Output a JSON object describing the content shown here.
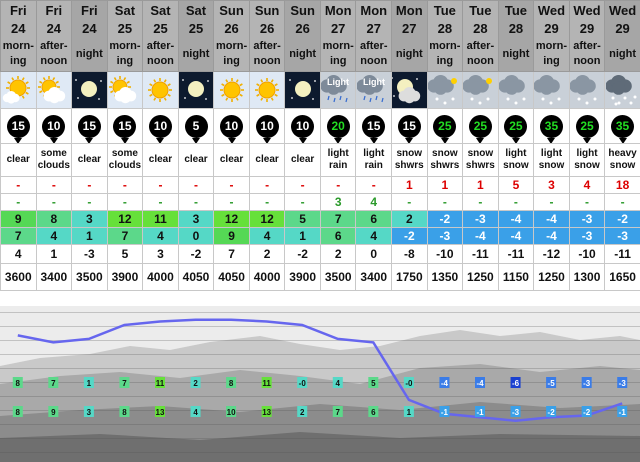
{
  "columns": [
    {
      "day": "Fri",
      "date": "24",
      "tod": [
        "morn-",
        "ing"
      ],
      "night": false,
      "icon": "sun-partly-cloudy-icon",
      "icon_bg": "bright",
      "wind": "15",
      "wind_color": "#ffffff",
      "cond": [
        "clear"
      ],
      "snow": "-",
      "rain": "-",
      "tmax": "9",
      "tmax_color": "#55d855",
      "tmin": "7",
      "tmin_color": "#5cd88a",
      "chill": "4",
      "fl": "3600"
    },
    {
      "day": "Fri",
      "date": "24",
      "tod": [
        "after-",
        "noon"
      ],
      "night": false,
      "icon": "sun-cloud-icon",
      "icon_bg": "bright",
      "wind": "10",
      "wind_color": "#ffffff",
      "cond": [
        "some",
        "clouds"
      ],
      "snow": "-",
      "rain": "-",
      "tmax": "8",
      "tmax_color": "#5cd88a",
      "tmin": "4",
      "tmin_color": "#55d8c6",
      "chill": "1",
      "fl": "3400"
    },
    {
      "day": "Fri",
      "date": "24",
      "tod": [
        "night"
      ],
      "night": true,
      "icon": "moon-icon",
      "icon_bg": "dark",
      "wind": "15",
      "wind_color": "#ffffff",
      "cond": [
        "clear"
      ],
      "snow": "-",
      "rain": "-",
      "tmax": "3",
      "tmax_color": "#55d8c6",
      "tmin": "1",
      "tmin_color": "#55d8c6",
      "chill": "-3",
      "fl": "3500"
    },
    {
      "day": "Sat",
      "date": "25",
      "tod": [
        "morn-",
        "ing"
      ],
      "night": false,
      "icon": "sun-cloud-icon",
      "icon_bg": "bright",
      "wind": "15",
      "wind_color": "#ffffff",
      "cond": [
        "some",
        "clouds"
      ],
      "snow": "-",
      "rain": "-",
      "tmax": "12",
      "tmax_color": "#66e03a",
      "tmin": "7",
      "tmin_color": "#5cd88a",
      "chill": "5",
      "fl": "3900"
    },
    {
      "day": "Sat",
      "date": "25",
      "tod": [
        "after-",
        "noon"
      ],
      "night": false,
      "icon": "sun-icon",
      "icon_bg": "bright",
      "wind": "10",
      "wind_color": "#ffffff",
      "cond": [
        "clear"
      ],
      "snow": "-",
      "rain": "-",
      "tmax": "11",
      "tmax_color": "#66e03a",
      "tmin": "4",
      "tmin_color": "#55d8c6",
      "chill": "3",
      "fl": "4000"
    },
    {
      "day": "Sat",
      "date": "25",
      "tod": [
        "night"
      ],
      "night": true,
      "icon": "moon-icon",
      "icon_bg": "dark",
      "wind": "5",
      "wind_color": "#ffffff",
      "cond": [
        "clear"
      ],
      "snow": "-",
      "rain": "-",
      "tmax": "3",
      "tmax_color": "#55d8c6",
      "tmin": "0",
      "tmin_color": "#55d8c6",
      "chill": "-2",
      "fl": "4050"
    },
    {
      "day": "Sun",
      "date": "26",
      "tod": [
        "morn-",
        "ing"
      ],
      "night": false,
      "icon": "sun-icon",
      "icon_bg": "bright",
      "wind": "10",
      "wind_color": "#ffffff",
      "cond": [
        "clear"
      ],
      "snow": "-",
      "rain": "-",
      "tmax": "12",
      "tmax_color": "#66e03a",
      "tmin": "9",
      "tmin_color": "#55d855",
      "chill": "7",
      "fl": "4050"
    },
    {
      "day": "Sun",
      "date": "26",
      "tod": [
        "after-",
        "noon"
      ],
      "night": false,
      "icon": "sun-icon",
      "icon_bg": "bright",
      "wind": "10",
      "wind_color": "#ffffff",
      "cond": [
        "clear"
      ],
      "snow": "-",
      "rain": "-",
      "tmax": "12",
      "tmax_color": "#66e03a",
      "tmin": "4",
      "tmin_color": "#55d8c6",
      "chill": "2",
      "fl": "4000"
    },
    {
      "day": "Sun",
      "date": "26",
      "tod": [
        "night"
      ],
      "night": true,
      "icon": "moon-icon",
      "icon_bg": "dark",
      "wind": "10",
      "wind_color": "#ffffff",
      "cond": [
        "clear"
      ],
      "snow": "-",
      "rain": "-",
      "tmax": "5",
      "tmax_color": "#5cd88a",
      "tmin": "1",
      "tmin_color": "#55d8c6",
      "chill": "-2",
      "fl": "3900"
    },
    {
      "day": "Mon",
      "date": "27",
      "tod": [
        "morn-",
        "ing"
      ],
      "night": false,
      "icon": "light-rain-icon",
      "icon_bg": "gray",
      "wind": "20",
      "wind_color": "#22dd22",
      "cond": [
        "light",
        "rain"
      ],
      "snow": "-",
      "rain": "3",
      "tmax": "7",
      "tmax_color": "#5cd88a",
      "tmin": "6",
      "tmin_color": "#5cd88a",
      "chill": "2",
      "fl": "3500"
    },
    {
      "day": "Mon",
      "date": "27",
      "tod": [
        "after-",
        "noon"
      ],
      "night": false,
      "icon": "light-rain-icon",
      "icon_bg": "gray",
      "wind": "15",
      "wind_color": "#ffffff",
      "cond": [
        "light",
        "rain"
      ],
      "snow": "-",
      "rain": "4",
      "tmax": "6",
      "tmax_color": "#5cd88a",
      "tmin": "4",
      "tmin_color": "#55d8c6",
      "chill": "0",
      "fl": "3400"
    },
    {
      "day": "Mon",
      "date": "27",
      "tod": [
        "night"
      ],
      "night": true,
      "icon": "moon-cloud-icon",
      "icon_bg": "dark",
      "wind": "15",
      "wind_color": "#ffffff",
      "cond": [
        "snow",
        "shwrs"
      ],
      "snow": "1",
      "rain": "-",
      "tmax": "2",
      "tmax_color": "#55d8c6",
      "tmin": "-2",
      "tmin_color": "#3aa0e8",
      "chill": "-8",
      "fl": "1750"
    },
    {
      "day": "Tue",
      "date": "28",
      "tod": [
        "morn-",
        "ing"
      ],
      "night": false,
      "icon": "snow-shower-icon",
      "icon_bg": "gray",
      "wind": "25",
      "wind_color": "#22dd22",
      "cond": [
        "snow",
        "shwrs"
      ],
      "snow": "1",
      "rain": "-",
      "tmax": "-2",
      "tmax_color": "#3aa0e8",
      "tmin": "-3",
      "tmin_color": "#3aa0e8",
      "chill": "-10",
      "fl": "1350"
    },
    {
      "day": "Tue",
      "date": "28",
      "tod": [
        "after-",
        "noon"
      ],
      "night": false,
      "icon": "snow-shower-icon",
      "icon_bg": "gray",
      "wind": "25",
      "wind_color": "#22dd22",
      "cond": [
        "snow",
        "shwrs"
      ],
      "snow": "1",
      "rain": "-",
      "tmax": "-3",
      "tmax_color": "#3aa0e8",
      "tmin": "-4",
      "tmin_color": "#3aa0e8",
      "chill": "-11",
      "fl": "1250"
    },
    {
      "day": "Tue",
      "date": "28",
      "tod": [
        "night"
      ],
      "night": true,
      "icon": "light-snow-icon",
      "icon_bg": "gray",
      "wind": "25",
      "wind_color": "#22dd22",
      "cond": [
        "light",
        "snow"
      ],
      "snow": "5",
      "rain": "-",
      "tmax": "-4",
      "tmax_color": "#3aa0e8",
      "tmin": "-4",
      "tmin_color": "#3aa0e8",
      "chill": "-11",
      "fl": "1150"
    },
    {
      "day": "Wed",
      "date": "29",
      "tod": [
        "morn-",
        "ing"
      ],
      "night": false,
      "icon": "light-snow-icon",
      "icon_bg": "gray",
      "wind": "35",
      "wind_color": "#22dd22",
      "cond": [
        "light",
        "snow"
      ],
      "snow": "3",
      "rain": "-",
      "tmax": "-4",
      "tmax_color": "#3aa0e8",
      "tmin": "-4",
      "tmin_color": "#3aa0e8",
      "chill": "-12",
      "fl": "1250"
    },
    {
      "day": "Wed",
      "date": "29",
      "tod": [
        "after-",
        "noon"
      ],
      "night": false,
      "icon": "light-snow-icon",
      "icon_bg": "gray",
      "wind": "25",
      "wind_color": "#22dd22",
      "cond": [
        "light",
        "snow"
      ],
      "snow": "4",
      "rain": "-",
      "tmax": "-3",
      "tmax_color": "#3aa0e8",
      "tmin": "-3",
      "tmin_color": "#3aa0e8",
      "chill": "-10",
      "fl": "1300"
    },
    {
      "day": "Wed",
      "date": "29",
      "tod": [
        "night"
      ],
      "night": true,
      "icon": "heavy-snow-icon",
      "icon_bg": "gray",
      "wind": "35",
      "wind_color": "#22dd22",
      "cond": [
        "heavy",
        "snow"
      ],
      "snow": "18",
      "rain": "-",
      "tmax": "-2",
      "tmax_color": "#3aa0e8",
      "tmin": "-3",
      "tmin_color": "#3aa0e8",
      "chill": "-11",
      "fl": "1650"
    }
  ],
  "icon_labels": {
    "light_rain": "Light"
  },
  "graph": {
    "upper_boxes": [
      "8",
      "7",
      "1",
      "7",
      "11",
      "2",
      "8",
      "11",
      "-0",
      "4",
      "5",
      "-0",
      "-4",
      "-4",
      "-6",
      "-5",
      "-3",
      "-3"
    ],
    "upper_colors": [
      "#5cd88a",
      "#5cd88a",
      "#55d8c6",
      "#5cd88a",
      "#66e03a",
      "#55d8c6",
      "#5cd88a",
      "#66e03a",
      "#55d8c6",
      "#55d8c6",
      "#5cd88a",
      "#55d8c6",
      "#3a7ce8",
      "#3a7ce8",
      "#1a40d0",
      "#3a7ce8",
      "#3a7ce8",
      "#3a7ce8"
    ],
    "lower_boxes": [
      "8",
      "9",
      "3",
      "8",
      "13",
      "4",
      "10",
      "13",
      "2",
      "7",
      "6",
      "1",
      "-1",
      "-1",
      "-3",
      "-2",
      "-2",
      "-1"
    ],
    "lower_colors": [
      "#5cd88a",
      "#5cd88a",
      "#55d8c6",
      "#5cd88a",
      "#66e03a",
      "#55d8c6",
      "#5cd88a",
      "#66e03a",
      "#55d8c6",
      "#5cd88a",
      "#5cd88a",
      "#55d8c6",
      "#3aa0e8",
      "#3aa0e8",
      "#3aa0e8",
      "#3aa0e8",
      "#3aa0e8",
      "#3aa0e8"
    ],
    "line_color": "#6666ee"
  }
}
